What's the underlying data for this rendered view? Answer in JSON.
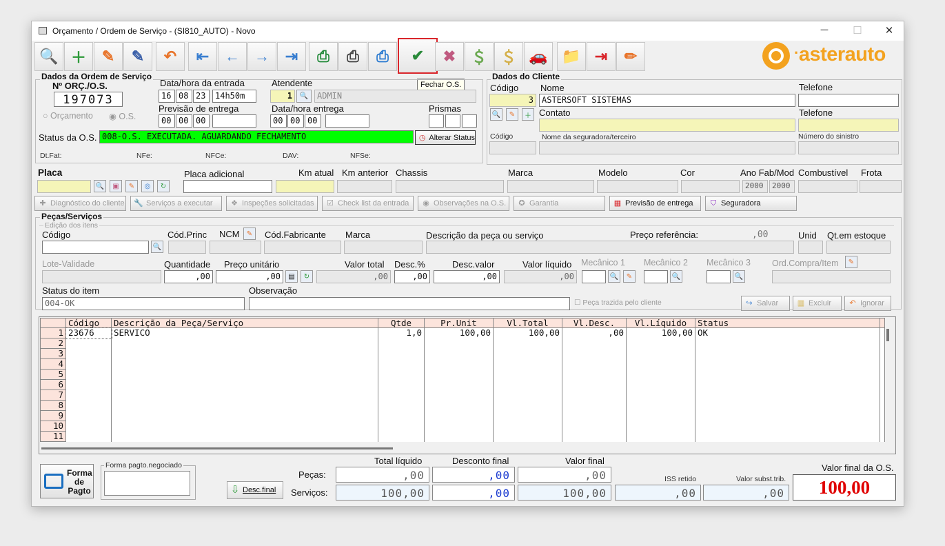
{
  "window": {
    "title": "Orçamento / Ordem de Serviço - (SI810_AUTO) - Novo",
    "minimize": "─",
    "maximize": "☐",
    "close": "✕"
  },
  "toolbar": {
    "tooltip": "Fechar O.S.",
    "buttons": [
      {
        "name": "search-document",
        "glyph": "🔍",
        "color": "#3a5fa8"
      },
      {
        "name": "new-document",
        "glyph": "＋",
        "color": "#2e9a3a"
      },
      {
        "name": "edit-document",
        "glyph": "✎",
        "color": "#e8742a"
      },
      {
        "name": "save-document",
        "glyph": "✎",
        "color": "#3a5fa8"
      },
      {
        "name": "undo",
        "glyph": "↶",
        "color": "#e8742a"
      },
      {
        "name": "first-record",
        "glyph": "⇤",
        "color": "#3a7fd0"
      },
      {
        "name": "previous-record",
        "glyph": "←",
        "color": "#3a7fd0"
      },
      {
        "name": "next-record",
        "glyph": "→",
        "color": "#3a7fd0"
      },
      {
        "name": "last-record",
        "glyph": "⇥",
        "color": "#3a7fd0"
      },
      {
        "name": "print-green",
        "glyph": "⎙",
        "color": "#238a3a"
      },
      {
        "name": "print-gray",
        "glyph": "⎙",
        "color": "#444"
      },
      {
        "name": "print-blue",
        "glyph": "⎙",
        "color": "#2a7ad0"
      },
      {
        "name": "close-os",
        "glyph": "✔",
        "color": "#2a8a3a"
      },
      {
        "name": "cancel-os",
        "glyph": "✖",
        "color": "#c05a80"
      },
      {
        "name": "money-add",
        "glyph": "＄",
        "color": "#6aa84f"
      },
      {
        "name": "money-cancel",
        "glyph": "＄",
        "color": "#d4b04a"
      },
      {
        "name": "car-service",
        "glyph": "🚗",
        "color": "#555"
      },
      {
        "name": "folder-search",
        "glyph": "📁",
        "color": "#2a8a3a"
      },
      {
        "name": "exit",
        "glyph": "⇥",
        "color": "#d9262b"
      },
      {
        "name": "pencil",
        "glyph": "✏",
        "color": "#e8742a"
      }
    ]
  },
  "logo": {
    "text": "asterauto",
    "color": "#f3a21f"
  },
  "os": {
    "group_title": "Dados da Ordem de Serviço",
    "num_label": "Nº ORÇ./O.S.",
    "num_value": "197073",
    "radio_orcamento": "Orçamento",
    "radio_os": "O.S.",
    "entrada_label": "Data/hora da entrada",
    "entrada_d": "16",
    "entrada_m": "08",
    "entrada_y": "23",
    "entrada_h": "14h50m",
    "atendente_label": "Atendente",
    "atendente_code": "1",
    "atendente_name": "ADMIN",
    "previsao_label": "Previsão de entrega",
    "previsao_d": "00",
    "previsao_m": "00",
    "previsao_y": "00",
    "data_entrega_label": "Data/hora entrega",
    "entrega_d": "00",
    "entrega_m": "00",
    "entrega_y": "00",
    "prismas_label": "Prismas",
    "status_label": "Status da O.S.",
    "status_value": "008-O.S. EXECUTADA. AGUARDANDO FECHAMENTO",
    "alterar_status": "Alterar Status",
    "dtfat": "Dt.Fat:",
    "nfe": "NFe:",
    "nfce": "NFCe:",
    "dav": "DAV:",
    "nfse": "NFSe:"
  },
  "cliente": {
    "group_title": "Dados do Cliente",
    "codigo_label": "Código",
    "codigo_value": "3",
    "nome_label": "Nome",
    "nome_value": "ASTERSOFT SISTEMAS",
    "telefone_label": "Telefone",
    "contato_label": "Contato",
    "telefone2_label": "Telefone",
    "codigo2_label": "Código",
    "seguradora_label": "Nome da seguradora/terceiro",
    "sinistro_label": "Número do sinistro"
  },
  "veiculo": {
    "placa_label": "Placa",
    "placa_adicional_label": "Placa adicional",
    "km_atual_label": "Km atual",
    "km_anterior_label": "Km anterior",
    "chassis_label": "Chassis",
    "marca_label": "Marca",
    "modelo_label": "Modelo",
    "cor_label": "Cor",
    "ano_label": "Ano Fab/Mod",
    "ano_fab": "2000",
    "ano_mod": "2000",
    "combustivel_label": "Combustível",
    "frota_label": "Frota"
  },
  "tabs": {
    "diagnostico": "Diagnóstico do cliente",
    "servicos": "Serviços a executar",
    "inspecoes": "Inspeções solicitadas",
    "checklist": "Check list da entrada",
    "observacoes": "Observações na O.S.",
    "garantia": "Garantia",
    "previsao": "Previsão de entrega",
    "seguradora": "Seguradora"
  },
  "pecas": {
    "group_title": "Peças/Serviços",
    "sub_title": "Edição dos itens",
    "codigo_label": "Código",
    "cod_princ_label": "Cód.Princ",
    "ncm_label": "NCM",
    "cod_fab_label": "Cód.Fabricante",
    "marca_label": "Marca",
    "descricao_label": "Descrição da peça ou serviço",
    "preco_ref_label": "Preço referência:",
    "preco_ref_value": ",00",
    "unid_label": "Unid",
    "qt_estoque_label": "Qt.em estoque",
    "lote_label": "Lote-Validade",
    "quantidade_label": "Quantidade",
    "quantidade_value": ",00",
    "preco_unit_label": "Preço unitário",
    "preco_unit_value": ",00",
    "valor_total_label": "Valor total",
    "valor_total_value": ",00",
    "desc_pct_label": "Desc.%",
    "desc_pct_value": ",00",
    "desc_valor_label": "Desc.valor",
    "desc_valor_value": ",00",
    "valor_liquido_label": "Valor líquido",
    "valor_liquido_value": ",00",
    "mecanico1_label": "Mecânico 1",
    "mecanico2_label": "Mecânico 2",
    "mecanico3_label": "Mecânico 3",
    "ord_compra_label": "Ord.Compra/Item",
    "status_item_label": "Status do item",
    "status_item_value": "004-OK",
    "observacao_label": "Observação",
    "peca_cliente_label": "Peça trazida pelo cliente",
    "salvar": "Salvar",
    "excluir": "Excluir",
    "ignorar": "Ignorar"
  },
  "grid": {
    "columns": [
      "Código",
      "Descrição da Peça/Serviço",
      "Qtde",
      "Pr.Unit",
      "Vl.Total",
      "Vl.Desc.",
      "Vl.Líquido",
      "Status"
    ],
    "rows": [
      {
        "n": "1",
        "codigo": "23676",
        "descricao": "SERVICO",
        "qtde": "1,0",
        "prunit": "100,00",
        "vltotal": "100,00",
        "vldesc": ",00",
        "vlliquido": "100,00",
        "status": "OK"
      },
      {
        "n": "2"
      },
      {
        "n": "3"
      },
      {
        "n": "4"
      },
      {
        "n": "5"
      },
      {
        "n": "6"
      },
      {
        "n": "7"
      },
      {
        "n": "8"
      },
      {
        "n": "9"
      },
      {
        "n": "10"
      },
      {
        "n": "11"
      }
    ]
  },
  "totais": {
    "forma_pagto": "Forma de Pagto",
    "forma_negociado_label": "Forma pagto.negociado",
    "desc_final_btn": "Desc.final",
    "total_liquido_label": "Total líquido",
    "desconto_final_label": "Desconto final",
    "valor_final_label": "Valor final",
    "pecas_label": "Peças:",
    "servicos_label": "Serviços:",
    "pecas_liquido": ",00",
    "pecas_desconto": ",00",
    "pecas_final": ",00",
    "serv_liquido": "100,00",
    "serv_desconto": ",00",
    "serv_final": "100,00",
    "iss_label": "ISS retido",
    "iss_value": ",00",
    "subst_label": "Valor subst.trib.",
    "subst_value": ",00",
    "valor_final_os_label": "Valor final da O.S.",
    "valor_final_os": "100,00"
  }
}
